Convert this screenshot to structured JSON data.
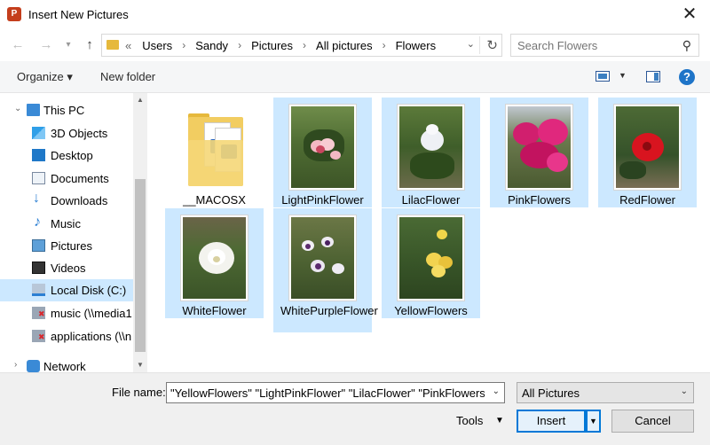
{
  "window": {
    "title": "Insert New Pictures",
    "app_icon": "P"
  },
  "nav": {
    "back_icon": "←",
    "forward_icon": "→",
    "up_icon": "↑",
    "breadcrumb_prefix": "«",
    "breadcrumb": [
      "Users",
      "Sandy",
      "Pictures",
      "All pictures",
      "Flowers"
    ],
    "search_placeholder": "Search Flowers"
  },
  "toolbar": {
    "organize": "Organize ▾",
    "new_folder": "New folder",
    "help": "?"
  },
  "sidebar": {
    "items": [
      {
        "label": "This PC",
        "icon": "pc-icon"
      },
      {
        "label": "3D Objects",
        "icon": "3d-objects-icon"
      },
      {
        "label": "Desktop",
        "icon": "desktop-icon"
      },
      {
        "label": "Documents",
        "icon": "documents-icon"
      },
      {
        "label": "Downloads",
        "icon": "downloads-icon"
      },
      {
        "label": "Music",
        "icon": "music-icon"
      },
      {
        "label": "Pictures",
        "icon": "pictures-icon"
      },
      {
        "label": "Videos",
        "icon": "videos-icon"
      },
      {
        "label": "Local Disk (C:)",
        "icon": "local-disk-icon",
        "selected": true
      },
      {
        "label": "music (\\\\media1",
        "icon": "network-drive-icon"
      },
      {
        "label": "applications (\\\\n",
        "icon": "network-drive-icon"
      },
      {
        "label": "Network",
        "icon": "network-icon"
      }
    ]
  },
  "files": [
    {
      "name": "__MACOSX",
      "type": "folder",
      "selected": false
    },
    {
      "name": "LightPinkFlower",
      "type": "image",
      "selected": true
    },
    {
      "name": "LilacFlower",
      "type": "image",
      "selected": true
    },
    {
      "name": "PinkFlowers",
      "type": "image",
      "selected": true
    },
    {
      "name": "RedFlower",
      "type": "image",
      "selected": true
    },
    {
      "name": "WhiteFlower",
      "type": "image",
      "selected": true
    },
    {
      "name": "WhitePurpleFlower",
      "type": "image",
      "selected": true
    },
    {
      "name": "YellowFlowers",
      "type": "image",
      "selected": true
    }
  ],
  "footer": {
    "file_name_label": "File name:",
    "file_name_value": "\"YellowFlowers\" \"LightPinkFlower\" \"LilacFlower\" \"PinkFlowers\" \"R",
    "file_type": "All Pictures",
    "tools": "Tools",
    "insert": "Insert",
    "cancel": "Cancel"
  },
  "colors": {
    "selection": "#cce8ff",
    "accent": "#0078d7"
  }
}
